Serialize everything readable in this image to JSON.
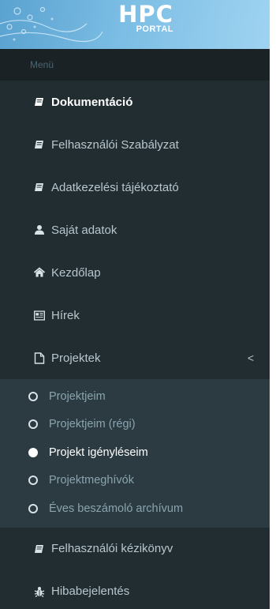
{
  "logo": {
    "main": "HPC",
    "sub": "PORTAL"
  },
  "menu_header": "Menü",
  "items": [
    {
      "label": "Dokumentáció",
      "icon": "book-icon"
    },
    {
      "label": "Felhasználói Szabályzat",
      "icon": "book-icon"
    },
    {
      "label": "Adatkezelési tájékoztató",
      "icon": "book-icon"
    },
    {
      "label": "Saját adatok",
      "icon": "user-icon"
    },
    {
      "label": "Kezdőlap",
      "icon": "home-icon"
    },
    {
      "label": "Hírek",
      "icon": "newspaper-icon"
    },
    {
      "label": "Projektek",
      "icon": "file-icon",
      "chevron": "<"
    }
  ],
  "submenu": [
    {
      "label": "Projektjeim"
    },
    {
      "label": "Projektjeim (régi)"
    },
    {
      "label": "Projekt igényléseim"
    },
    {
      "label": "Projektmeghívók"
    },
    {
      "label": "Éves beszámoló archívum"
    }
  ],
  "after_items": [
    {
      "label": "Felhasználói kézikönyv",
      "icon": "book-icon"
    },
    {
      "label": "Hibabejelentés",
      "icon": "bug-icon"
    }
  ],
  "colors": {
    "sidebar_bg": "#222d32",
    "submenu_bg": "#2c3b41",
    "logo_bg": "#7bbde4"
  }
}
